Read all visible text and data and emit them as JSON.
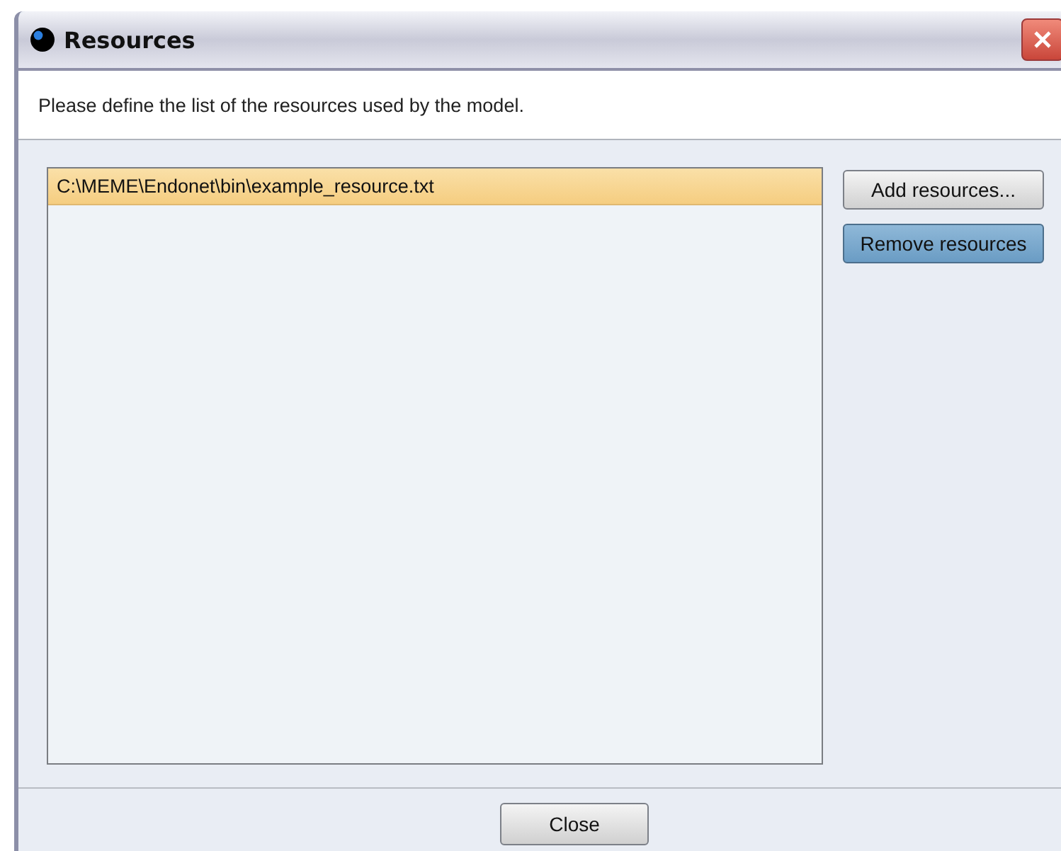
{
  "window": {
    "title": "Resources"
  },
  "description": "Please define the list of the resources used by the model.",
  "resources": [
    {
      "path": "C:\\MEME\\Endonet\\bin\\example_resource.txt",
      "selected": true
    }
  ],
  "buttons": [
    {
      "label": "Add resources...",
      "focused": false
    },
    {
      "label": "Remove resources",
      "focused": true
    }
  ],
  "footer_button": "Close"
}
